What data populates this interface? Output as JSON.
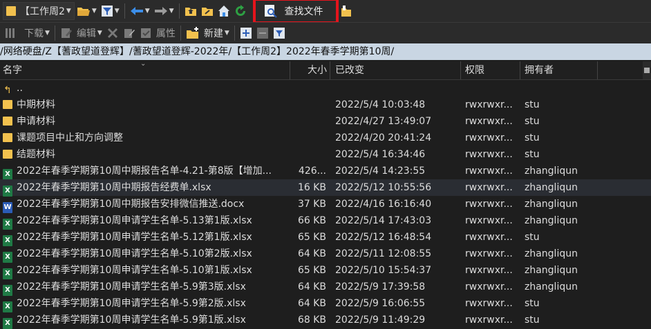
{
  "toolbar1": {
    "drive_label": "【工作周2",
    "find_label": "查找文件",
    "icons": [
      "folder-icon",
      "folder-open-icon",
      "filter-icon",
      "back-arrow-icon",
      "forward-arrow-icon",
      "parent-folder-icon",
      "root-folder-icon",
      "home-icon",
      "refresh-icon",
      "find-icon",
      "bookmark-icon"
    ]
  },
  "toolbar2": {
    "download_label": "下载",
    "edit_label": "编辑",
    "properties_label": "属性",
    "new_label": "新建"
  },
  "path": "/网络硬盘/Z【蓍政望道登辉】/蓍政望道登辉-2022年/【工作周2】2022年春季学期第10周/",
  "columns": {
    "name": "名字",
    "size": "大小",
    "modified": "已改变",
    "permissions": "权限",
    "owner": "拥有者"
  },
  "files": [
    {
      "name": "..",
      "size": "",
      "modified": "",
      "permissions": "",
      "owner": "",
      "type": "up"
    },
    {
      "name": "中期材料",
      "size": "",
      "modified": "2022/5/4 10:03:48",
      "permissions": "rwxrwxr...",
      "owner": "stu",
      "type": "folder"
    },
    {
      "name": "申请材料",
      "size": "",
      "modified": "2022/4/27 13:49:07",
      "permissions": "rwxrwxr...",
      "owner": "stu",
      "type": "folder"
    },
    {
      "name": "课题项目中止和方向调整",
      "size": "",
      "modified": "2022/4/20 20:41:24",
      "permissions": "rwxrwxr...",
      "owner": "stu",
      "type": "folder"
    },
    {
      "name": "结题材料",
      "size": "",
      "modified": "2022/5/4 16:34:46",
      "permissions": "rwxrwxr...",
      "owner": "stu",
      "type": "folder"
    },
    {
      "name": "2022年春季学期第10周中期报告名单-4.21-第8版【增加...",
      "size": "426...",
      "modified": "2022/5/4 14:23:55",
      "permissions": "rwxrwxr...",
      "owner": "zhangliqun",
      "type": "xlsx"
    },
    {
      "name": "2022年春季学期第10周中期报告经费单.xlsx",
      "size": "16 KB",
      "modified": "2022/5/12 10:55:56",
      "permissions": "rwxrwxr...",
      "owner": "zhangliqun",
      "type": "xlsx"
    },
    {
      "name": "2022年春季学期第10周中期报告安排微信推送.docx",
      "size": "37 KB",
      "modified": "2022/4/16 16:16:40",
      "permissions": "rwxrwxr...",
      "owner": "zhangliqun",
      "type": "docx"
    },
    {
      "name": "2022年春季学期第10周申请学生名单-5.13第1版.xlsx",
      "size": "66 KB",
      "modified": "2022/5/14 17:43:03",
      "permissions": "rwxrwxr...",
      "owner": "zhangliqun",
      "type": "xlsx"
    },
    {
      "name": "2022年春季学期第10周申请学生名单-5.12第1版.xlsx",
      "size": "65 KB",
      "modified": "2022/5/12 16:48:54",
      "permissions": "rwxrwxr...",
      "owner": "stu",
      "type": "xlsx"
    },
    {
      "name": "2022年春季学期第10周申请学生名单-5.10第2版.xlsx",
      "size": "64 KB",
      "modified": "2022/5/11 12:08:55",
      "permissions": "rwxrwxr...",
      "owner": "zhangliqun",
      "type": "xlsx"
    },
    {
      "name": "2022年春季学期第10周申请学生名单-5.10第1版.xlsx",
      "size": "65 KB",
      "modified": "2022/5/10 15:54:37",
      "permissions": "rwxrwxr...",
      "owner": "zhangliqun",
      "type": "xlsx"
    },
    {
      "name": "2022年春季学期第10周申请学生名单-5.9第3版.xlsx",
      "size": "64 KB",
      "modified": "2022/5/9 17:39:58",
      "permissions": "rwxrwxr...",
      "owner": "zhangliqun",
      "type": "xlsx"
    },
    {
      "name": "2022年春季学期第10周申请学生名单-5.9第2版.xlsx",
      "size": "64 KB",
      "modified": "2022/5/9 16:06:55",
      "permissions": "rwxrwxr...",
      "owner": "stu",
      "type": "xlsx"
    },
    {
      "name": "2022年春季学期第10周申请学生名单-5.9第1版.xlsx",
      "size": "68 KB",
      "modified": "2022/5/9 11:49:29",
      "permissions": "rwxrwxr...",
      "owner": "stu",
      "type": "xlsx"
    }
  ],
  "selected_row": 6,
  "colors": {
    "path_bg": "#c9d6e3",
    "highlight_border": "#e6141c",
    "folder": "#f2c14e",
    "excel": "#1f7a45",
    "word": "#2b5cb6"
  }
}
